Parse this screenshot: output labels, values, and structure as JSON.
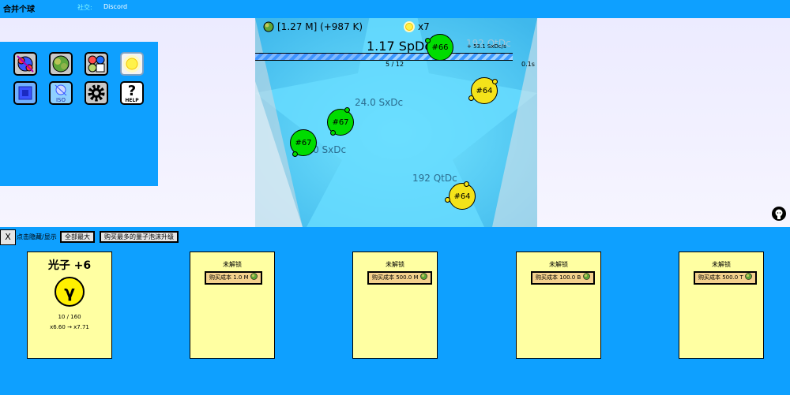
{
  "header": {
    "title": "合并个球",
    "social_label": "社交:",
    "discord_label": "Discord"
  },
  "menu": {
    "items": [
      {
        "name": "merge-balls-icon"
      },
      {
        "name": "planet-upgrade-icon"
      },
      {
        "name": "shop-icon"
      },
      {
        "name": "sun-icon",
        "selected": true
      },
      {
        "name": "chip-icon"
      },
      {
        "name": "iso-icon",
        "label": "ISO"
      },
      {
        "name": "gear-icon"
      },
      {
        "name": "help-icon",
        "label": "HELP"
      }
    ]
  },
  "game": {
    "currency": "[1.27 M] (+987 K)",
    "multiplier": "x7",
    "main_value": "1.17 SpDc",
    "rate": "+ 53.1 SxDc/s",
    "ghost_value": "192 QtDc",
    "progress_text": "5 / 12",
    "progress": 0.42,
    "timer": "0.1s",
    "balls": [
      {
        "id": "ball-66",
        "label": "#66",
        "color": "green"
      },
      {
        "id": "ball-64-top",
        "label": "#64",
        "color": "yellow"
      },
      {
        "id": "ball-67-a",
        "label": "#67",
        "color": "green"
      },
      {
        "id": "ball-67-b",
        "label": "#67",
        "color": "green"
      },
      {
        "id": "ball-64-bottom",
        "label": "#64",
        "color": "yellow"
      }
    ],
    "value_labels": [
      "24.0 SxDc",
      "24.0 SxDc",
      "192 QtDc"
    ]
  },
  "controls": {
    "close_label": "X",
    "toggle_hint": "点击隐藏/显示",
    "maximize_all": "全部最大",
    "buy_most": "购买最多的量子泡沫升级"
  },
  "cards": [
    {
      "title": "光子 +6",
      "symbol": "γ",
      "level": "10 / 160",
      "effect": "x6.60 → x7.71"
    },
    {
      "status": "未解锁",
      "cost": "购买成本 1.0 M"
    },
    {
      "status": "未解锁",
      "cost": "购买成本 500.0 M"
    },
    {
      "status": "未解锁",
      "cost": "购买成本 100.0 B"
    },
    {
      "status": "未解锁",
      "cost": "购买成本 500.0 T"
    }
  ],
  "colors": {
    "background": "#0ea0ff",
    "card": "#ffffa2",
    "green_ball": "#00dc00",
    "yellow_ball": "#f4e31a"
  }
}
